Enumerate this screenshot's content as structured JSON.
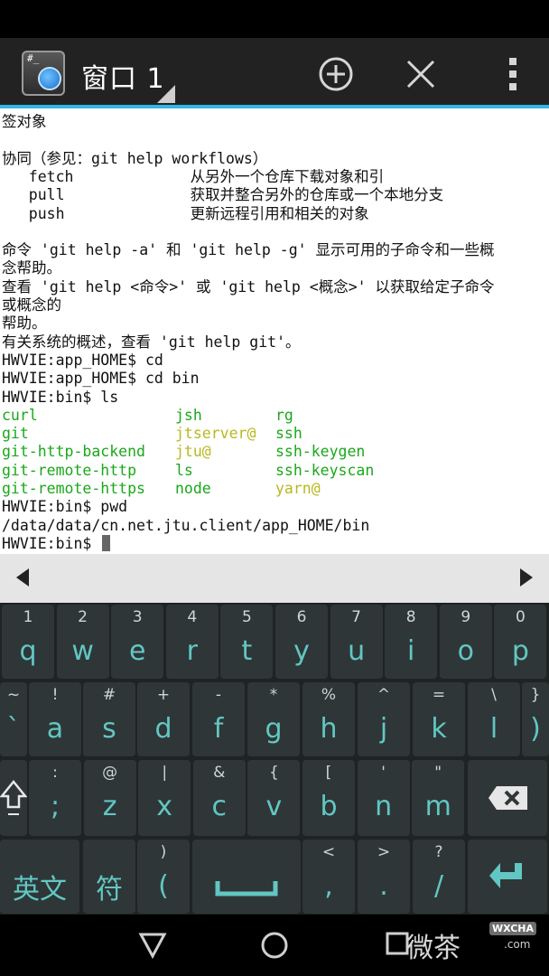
{
  "app_bar": {
    "title": "窗口 1",
    "accent": "#33b5e5"
  },
  "terminal": {
    "lines": [
      {
        "text": "签对象",
        "color": "default"
      },
      {
        "text": "",
        "color": "default"
      },
      {
        "text": "协同（参见：git help workflows）",
        "color": "default"
      },
      {
        "text": "   fetch             从另外一个仓库下载对象和引",
        "color": "default"
      },
      {
        "text": "   pull              获取并整合另外的仓库或一个本地分支",
        "color": "default"
      },
      {
        "text": "   push              更新远程引用和相关的对象",
        "color": "default"
      },
      {
        "text": "",
        "color": "default"
      },
      {
        "text": "命令 'git help -a' 和 'git help -g' 显示可用的子命令和一些概",
        "color": "default"
      },
      {
        "text": "念帮助。",
        "color": "default"
      },
      {
        "text": "查看 'git help <命令>' 或 'git help <概念>' 以获取给定子命令",
        "color": "default"
      },
      {
        "text": "或概念的",
        "color": "default"
      },
      {
        "text": "帮助。",
        "color": "default"
      },
      {
        "text": "有关系统的概述，查看 'git help git'。",
        "color": "default"
      },
      {
        "text": "HWVIE:app_HOME$ cd",
        "color": "default"
      },
      {
        "text": "HWVIE:app_HOME$ cd bin",
        "color": "default"
      },
      {
        "text": "HWVIE:bin$ ls",
        "color": "default"
      }
    ],
    "ls_rows": [
      [
        {
          "t": "curl",
          "c": "green"
        },
        {
          "t": "jsh",
          "c": "green"
        },
        {
          "t": "rg",
          "c": "green"
        }
      ],
      [
        {
          "t": "git",
          "c": "green"
        },
        {
          "t": "jtserver@",
          "c": "yellow"
        },
        {
          "t": "ssh",
          "c": "green"
        }
      ],
      [
        {
          "t": "git-http-backend",
          "c": "green"
        },
        {
          "t": "jtu@",
          "c": "yellow"
        },
        {
          "t": "ssh-keygen",
          "c": "green"
        }
      ],
      [
        {
          "t": "git-remote-http",
          "c": "green"
        },
        {
          "t": "ls",
          "c": "green"
        },
        {
          "t": "ssh-keyscan",
          "c": "green"
        }
      ],
      [
        {
          "t": "git-remote-https",
          "c": "green"
        },
        {
          "t": "node",
          "c": "green"
        },
        {
          "t": "yarn@",
          "c": "yellow"
        }
      ]
    ],
    "after_lines": [
      {
        "text": "HWVIE:bin$ pwd",
        "color": "default"
      },
      {
        "text": "/data/data/cn.net.jtu.client/app_HOME/bin",
        "color": "default"
      },
      {
        "text": "HWVIE:bin$ ",
        "color": "default"
      }
    ],
    "colors": {
      "default": "#111111",
      "green": "#1aa81a",
      "yellow": "#b8b820"
    }
  },
  "keyboard": {
    "row1": [
      {
        "alt": "1",
        "main": "q"
      },
      {
        "alt": "2",
        "main": "w"
      },
      {
        "alt": "3",
        "main": "e"
      },
      {
        "alt": "4",
        "main": "r"
      },
      {
        "alt": "5",
        "main": "t"
      },
      {
        "alt": "6",
        "main": "y"
      },
      {
        "alt": "7",
        "main": "u"
      },
      {
        "alt": "8",
        "main": "i"
      },
      {
        "alt": "9",
        "main": "o"
      },
      {
        "alt": "0",
        "main": "p"
      }
    ],
    "row2": [
      {
        "alt": "~",
        "main": "`"
      },
      {
        "alt": "!",
        "main": "a"
      },
      {
        "alt": "#",
        "main": "s"
      },
      {
        "alt": "+",
        "main": "d"
      },
      {
        "alt": "-",
        "main": "f"
      },
      {
        "alt": "*",
        "main": "g"
      },
      {
        "alt": "%",
        "main": "h"
      },
      {
        "alt": "^",
        "main": "j"
      },
      {
        "alt": "=",
        "main": "k"
      },
      {
        "alt": "\\",
        "main": "l"
      },
      {
        "alt": "}",
        "main": ")"
      }
    ],
    "row3": [
      {
        "alt": ":",
        "main": ";"
      },
      {
        "alt": "@",
        "main": "z"
      },
      {
        "alt": "|",
        "main": "x"
      },
      {
        "alt": "&",
        "main": "c"
      },
      {
        "alt": "{",
        "main": "v"
      },
      {
        "alt": "[",
        "main": "b"
      },
      {
        "alt": "'",
        "main": "n"
      },
      {
        "alt": "\"",
        "main": "m"
      }
    ],
    "row4": {
      "lang": "英文",
      "symbol": "符",
      "paren": {
        "alt": ")",
        "main": "("
      },
      "comma": {
        "alt": "<",
        "main": ","
      },
      "period": {
        "alt": ">",
        "main": "."
      },
      "slash": {
        "alt": "?",
        "main": "/"
      }
    },
    "key_text_color": "#61c7c3"
  },
  "watermark": {
    "text": "微茶",
    "badge": "WXCHA",
    "domain": ".com"
  }
}
